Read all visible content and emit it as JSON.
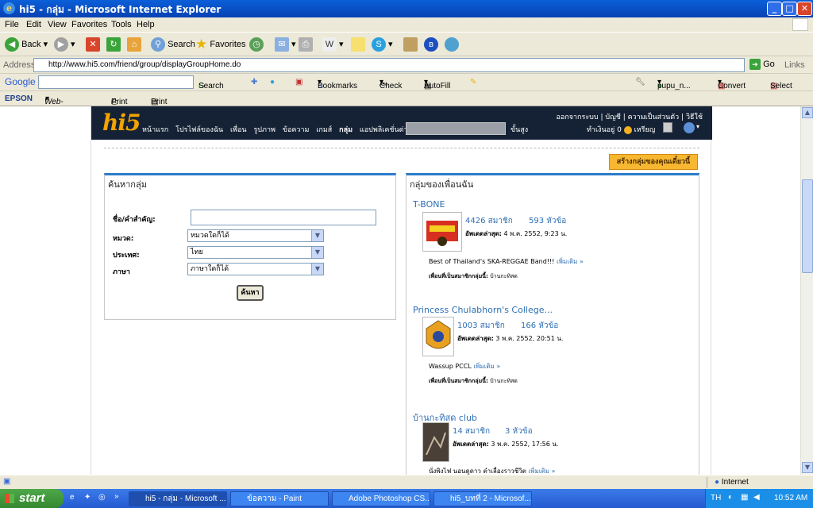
{
  "window": {
    "title": "hi5 - กลุ่ม - Microsoft Internet Explorer"
  },
  "menu": [
    "File",
    "Edit",
    "View",
    "Favorites",
    "Tools",
    "Help"
  ],
  "toolbar": {
    "back": "Back",
    "search": "Search",
    "favorites": "Favorites"
  },
  "address": {
    "label": "Address",
    "url": "http://www.hi5.com/friend/group/displayGroupHome.do",
    "go": "Go",
    "links": "Links"
  },
  "googlebar": {
    "logo": "Google",
    "search": "Search",
    "bookmarks": "Bookmarks",
    "check": "Check",
    "autofill": "AutoFill",
    "user": "pupu_n...",
    "convert": "Convert",
    "select": "Select"
  },
  "epsonbar": {
    "brand": "EPSON",
    "webtopage": "Web-To-Page",
    "print": "Print",
    "preview": "Print Preview"
  },
  "hi5": {
    "logo": "hi5",
    "nav": [
      "หน้าแรก",
      "โปรไฟล์ของฉัน",
      "เพื่อน",
      "รูปภาพ",
      "ข้อความ",
      "เกมส์",
      "กลุ่ม",
      "แอปพลิเคชั่นต่างๆ"
    ],
    "advanced": "ขั้นสูง",
    "topright": "ออกจากระบบ | บัญชี | ความเป็นส่วนตัว | วิธีใช้",
    "coins_label": "ทำเงินอยู่",
    "coins_value": "0",
    "coins_unit": "เหรียญ"
  },
  "create_group": "สร้างกลุ่มของคุณเดี๋ยวนี้",
  "search_box": {
    "title": "ค้นหากลุ่ม",
    "keyword_label": "ชื่อ/คำสำคัญ:",
    "keyword_value": "",
    "category_label": "หมวด:",
    "category_value": "หมวดใดก็ได้",
    "country_label": "ประเทศ:",
    "country_value": "ไทย",
    "language_label": "ภาษา",
    "language_value": "ภาษาใดก็ได้",
    "submit": "ค้นหา"
  },
  "groups_box": {
    "title": "กลุ่มของเพื่อนฉัน",
    "updated_label": "อัพเดตล่าสุด:",
    "more": "เพิ่มเติม »",
    "friends_label": "เพื่อนที่เป็นสมาชิกกลุ่มนี้:",
    "groups": [
      {
        "name": "T-BONE",
        "members": "4426 สมาชิก",
        "topics": "593 หัวข้อ",
        "updated": "4 พ.ค. 2552, 9:23 น.",
        "desc": "Best of Thailand's SKA-REGGAE Band!!!",
        "friends": "บ้านกะทิสด"
      },
      {
        "name": "Princess Chulabhorn's College...",
        "members": "1003 สมาชิก",
        "topics": "166 หัวข้อ",
        "updated": "3 พ.ค. 2552, 20:51 น.",
        "desc": "Wassup PCCL",
        "friends": "บ้านกะทิสด"
      },
      {
        "name": "บ้านกะทิสด club",
        "members": "14 สมาชิก",
        "topics": "3 หัวข้อ",
        "updated": "3 พ.ค. 2552, 17:56 น.",
        "desc": "นั่งพิงไฟ นอนดูดาว ตำเลื่องราวชีวิต",
        "friends": ""
      }
    ]
  },
  "status": {
    "zone": "Internet"
  },
  "taskbar": {
    "start": "start",
    "tasks": [
      "hi5 - กลุ่ม - Microsoft ...",
      "ข้อความ - Paint",
      "Adobe Photoshop CS...",
      "hi5_บทที่ 2 - Microsof..."
    ],
    "lang": "TH",
    "clock": "10:52 AM"
  }
}
